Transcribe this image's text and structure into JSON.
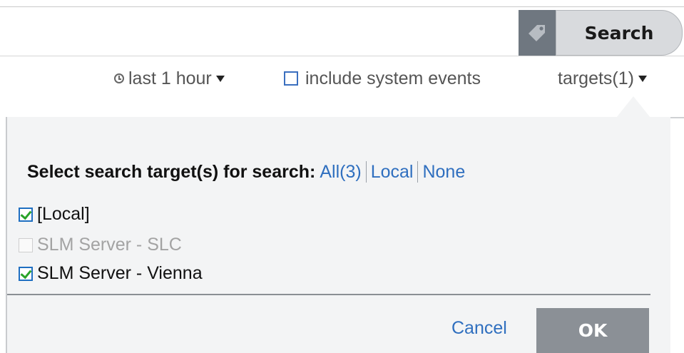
{
  "search": {
    "placeholder": "",
    "value": "",
    "button_label": "Search",
    "tag_icon": "tag-icon"
  },
  "options": {
    "time_range_label": "last 1 hour",
    "include_system_events_label": "include system events",
    "include_system_events_checked": false,
    "targets_label": "targets(1)"
  },
  "target_dialog": {
    "title": "Select search target(s) for search:",
    "links": {
      "all": "All(3)",
      "local": "Local",
      "none": "None"
    },
    "items": [
      {
        "label": "[Local]",
        "checked": true,
        "enabled": true
      },
      {
        "label": "SLM Server - SLC",
        "checked": false,
        "enabled": false
      },
      {
        "label": "SLM Server - Vienna",
        "checked": true,
        "enabled": true
      }
    ],
    "cancel_label": "Cancel",
    "ok_label": "OK"
  },
  "colors": {
    "link": "#2f6fbf",
    "check_green": "#29a329",
    "ok_button": "#8b9096",
    "panel_bg": "#f3f4f5"
  }
}
